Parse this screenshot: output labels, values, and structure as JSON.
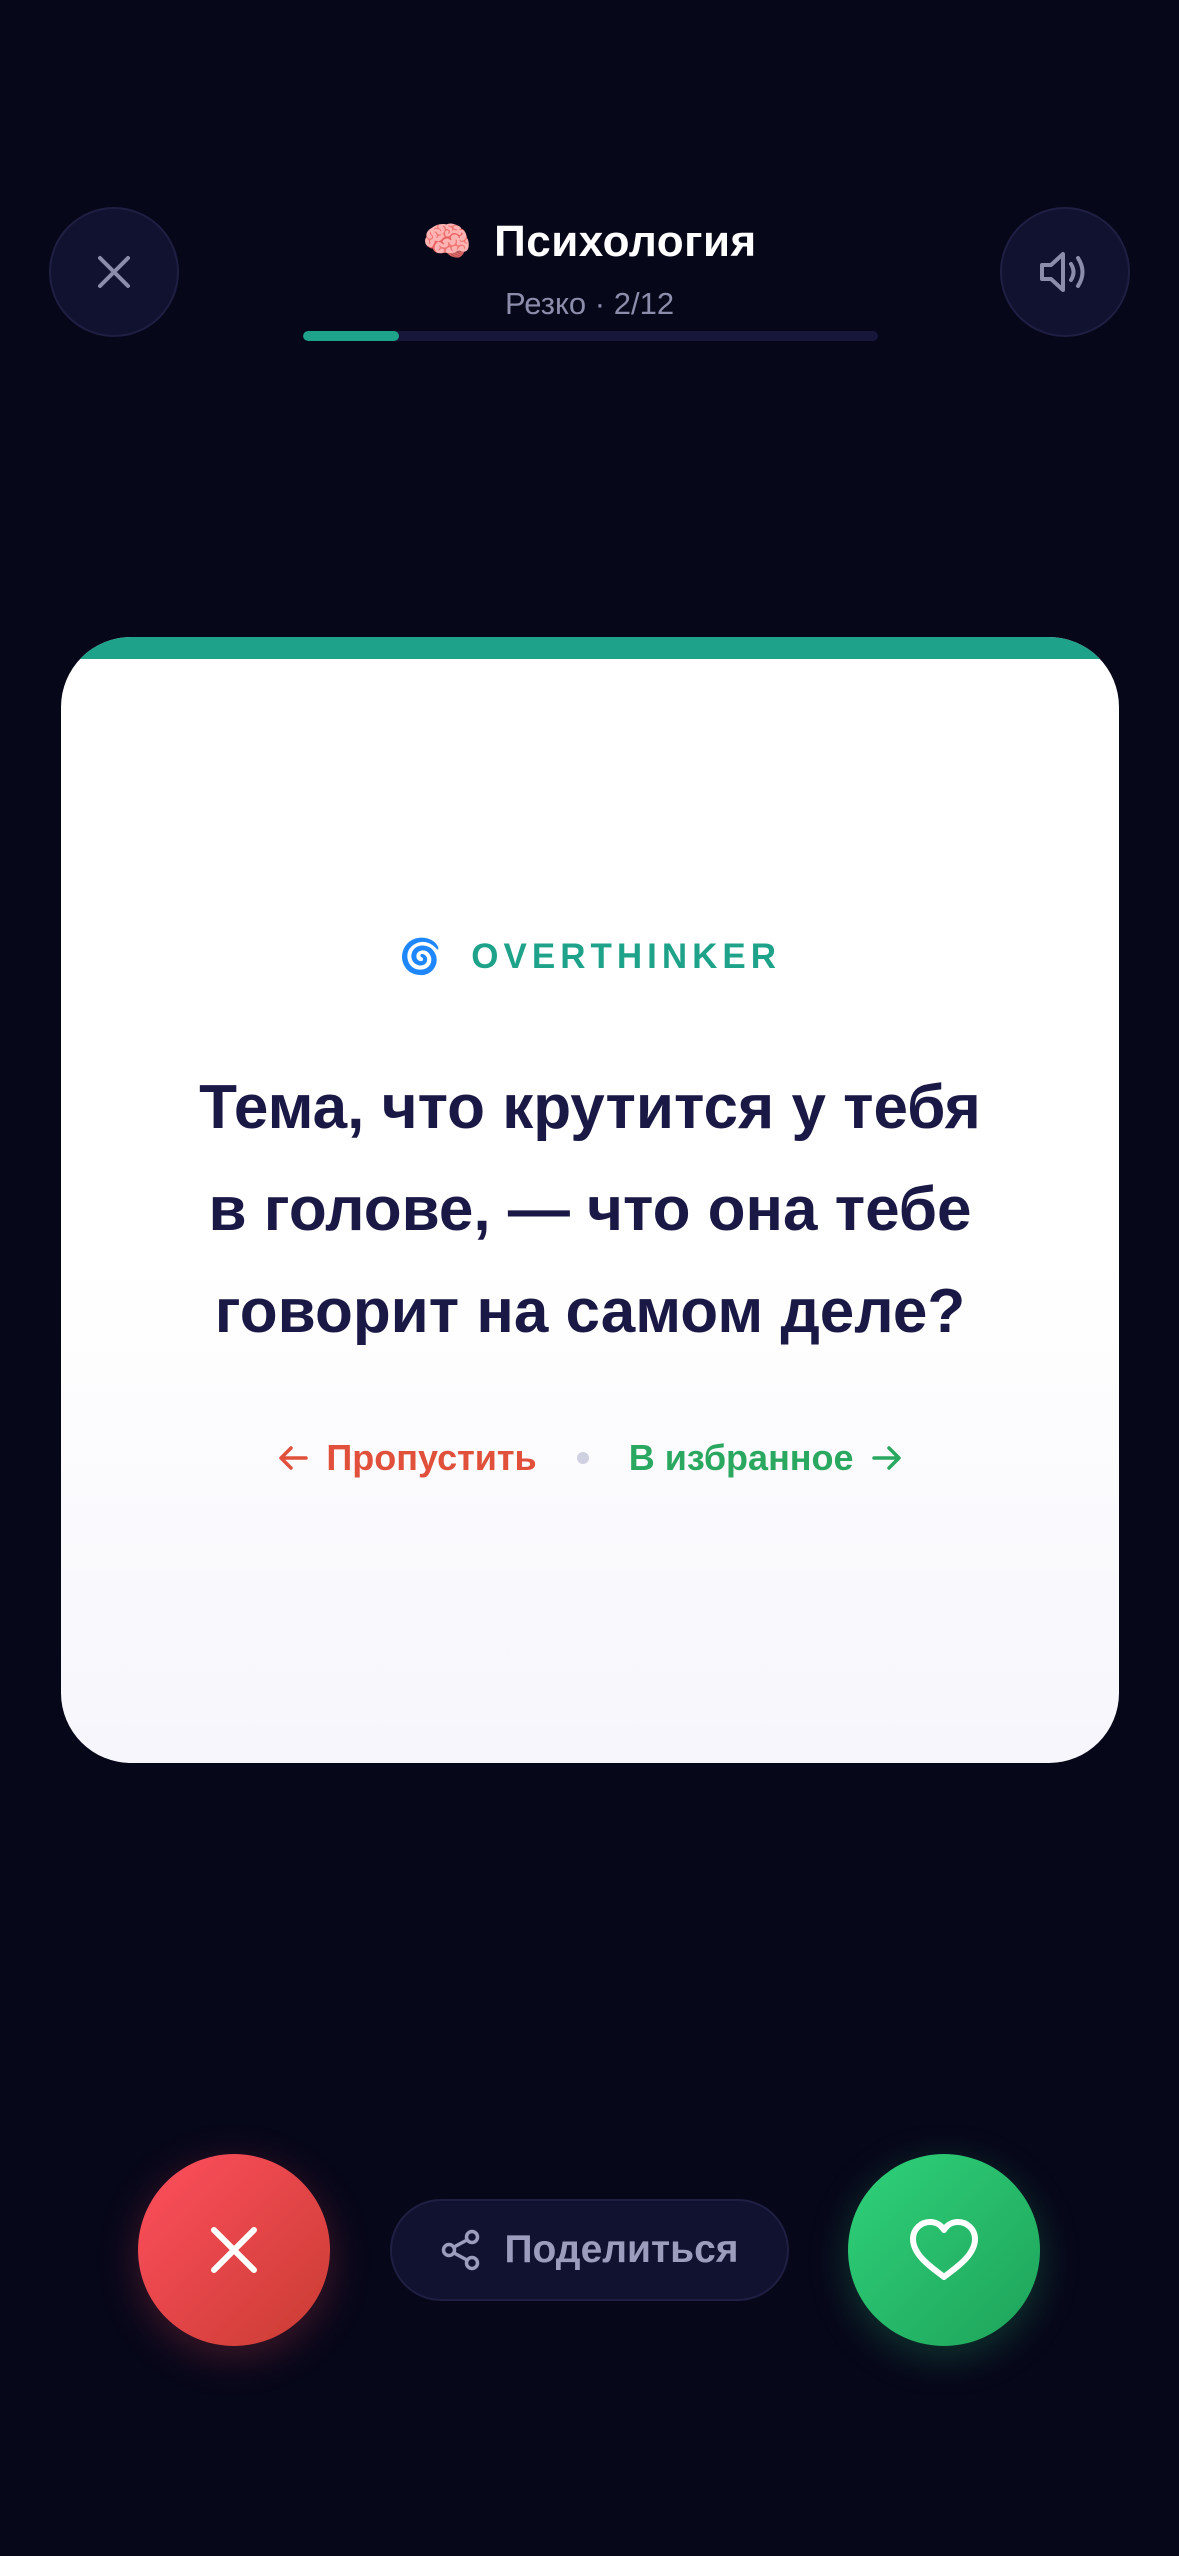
{
  "header": {
    "category_emoji": "🧠",
    "category_title": "Психология",
    "subtitle": "Резко · 2/12",
    "progress": 0.1667
  },
  "card": {
    "tag_emoji": "🌀",
    "tag_label": "OVERTHINKER",
    "question_lines": [
      "Тема, что крутится у тебя",
      "в голове, — что она тебе",
      "говорит на самом деле?"
    ],
    "skip_hint": "Пропустить",
    "favorite_hint": "В избранное"
  },
  "actions": {
    "share_label": "Поделиться"
  },
  "colors": {
    "background": "#07071a",
    "accent": "#1ea38a",
    "skip": "#e0503a",
    "favorite": "#2aa860",
    "question_text": "#1a1845"
  },
  "icons": {
    "close": "close-icon",
    "sound": "speaker-icon",
    "share": "share-icon",
    "dislike": "x-icon",
    "like": "heart-icon"
  }
}
